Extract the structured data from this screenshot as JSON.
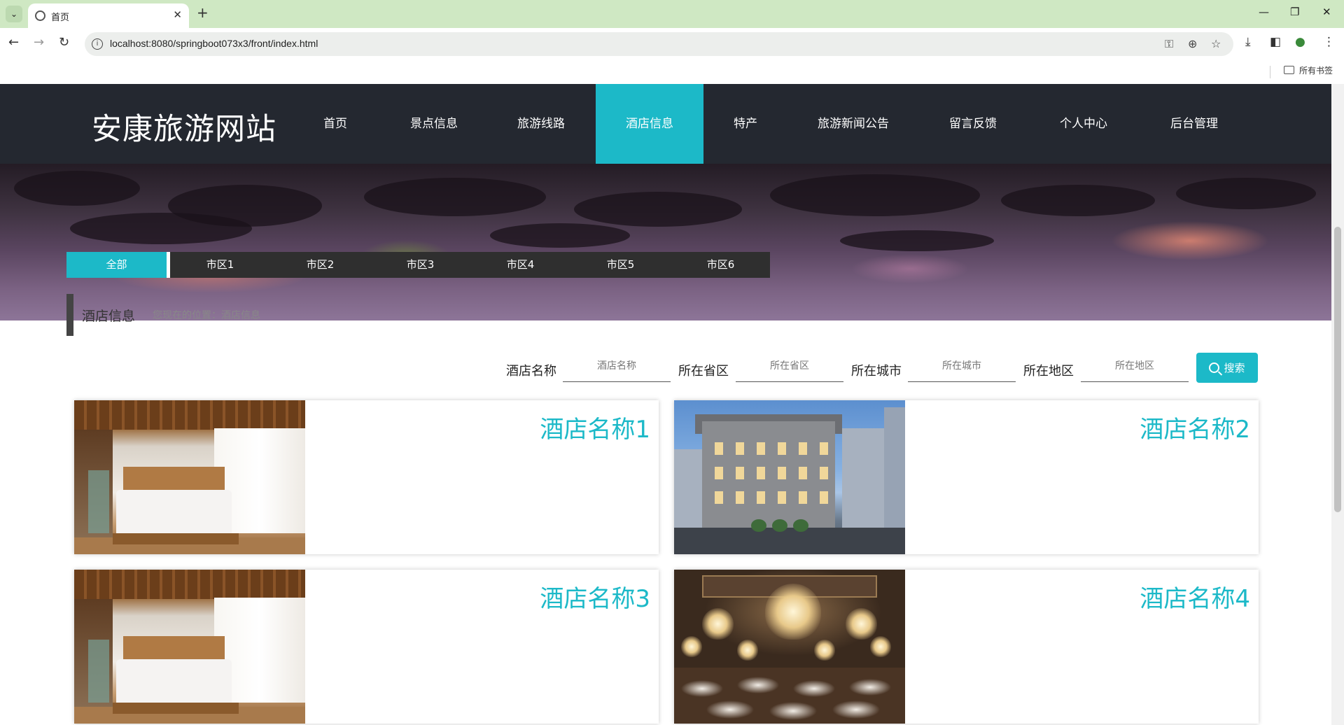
{
  "browser": {
    "tab_title": "首页",
    "url": "localhost:8080/springboot073x3/front/index.html",
    "bookmarks_label": "所有书签"
  },
  "site": {
    "title": "安康旅游网站"
  },
  "nav": {
    "items": [
      "首页",
      "景点信息",
      "旅游线路",
      "酒店信息",
      "特产",
      "旅游新闻公告",
      "留言反馈",
      "个人中心",
      "后台管理"
    ],
    "active": "酒店信息"
  },
  "filters": {
    "items": [
      "全部",
      "市区1",
      "市区2",
      "市区3",
      "市区4",
      "市区5",
      "市区6"
    ],
    "active": "全部"
  },
  "section": {
    "title": "酒店信息",
    "breadcrumb": "您现在的位置：酒店信息"
  },
  "search": {
    "fields": [
      {
        "label": "酒店名称",
        "placeholder": "酒店名称"
      },
      {
        "label": "所在省区",
        "placeholder": "所在省区"
      },
      {
        "label": "所在城市",
        "placeholder": "所在城市"
      },
      {
        "label": "所在地区",
        "placeholder": "所在地区"
      }
    ],
    "button_label": "搜索"
  },
  "hotels": [
    {
      "name": "酒店名称1",
      "image": "hotel-bedroom"
    },
    {
      "name": "酒店名称2",
      "image": "hotel-building"
    },
    {
      "name": "酒店名称3",
      "image": "hotel-bedroom"
    },
    {
      "name": "酒店名称4",
      "image": "hotel-ballroom"
    }
  ],
  "colors": {
    "accent": "#1cb9c8",
    "header_bg": "#242830",
    "filter_bg": "#2f2f2f"
  }
}
